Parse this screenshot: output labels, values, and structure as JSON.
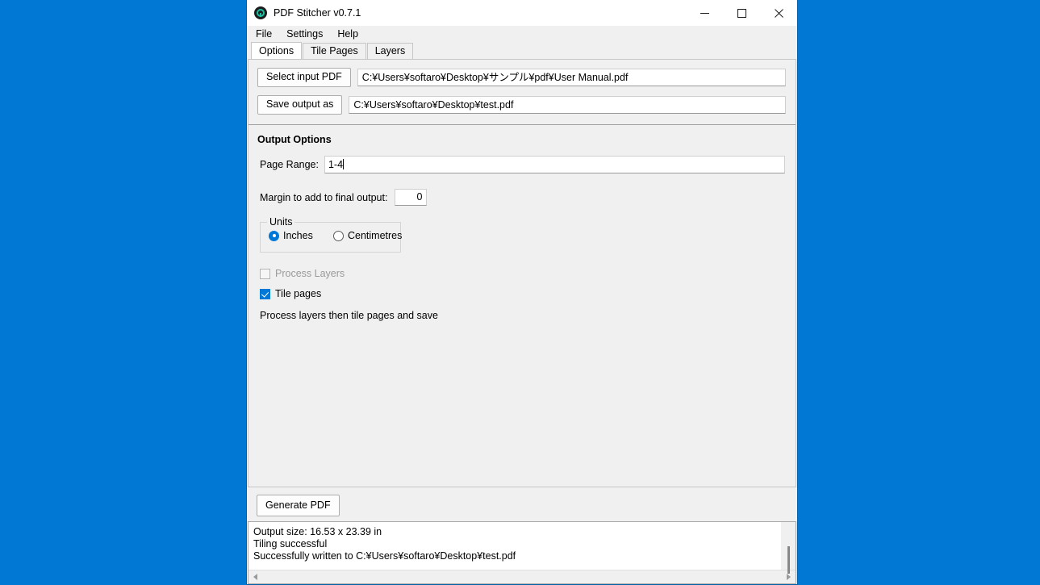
{
  "desktop": {
    "background_color": "#0078d4"
  },
  "window": {
    "title": "PDF Stitcher v0.7.1",
    "icon": "pdf-stitcher-app-icon",
    "controls": {
      "minimize": "minimize-icon",
      "maximize": "maximize-icon",
      "close": "close-icon"
    }
  },
  "menu": {
    "items": [
      {
        "label": "File"
      },
      {
        "label": "Settings"
      },
      {
        "label": "Help"
      }
    ]
  },
  "tabs": [
    {
      "label": "Options",
      "active": true
    },
    {
      "label": "Tile Pages",
      "active": false
    },
    {
      "label": "Layers",
      "active": false
    }
  ],
  "options_tab": {
    "input_row": {
      "button_label": "Select input PDF",
      "path_value": "C:¥Users¥softaro¥Desktop¥サンプル¥pdf¥User Manual.pdf"
    },
    "output_row": {
      "button_label": "Save output as",
      "path_value": "C:¥Users¥softaro¥Desktop¥test.pdf"
    },
    "output_options": {
      "title": "Output Options",
      "page_range": {
        "label": "Page Range:",
        "value": "1-4"
      },
      "margin": {
        "label": "Margin to add to final output:",
        "value": "0"
      },
      "units": {
        "legend": "Units",
        "selected": "Inches",
        "options": [
          {
            "label": "Inches",
            "checked": true
          },
          {
            "label": "Centimetres",
            "checked": false
          }
        ]
      },
      "process_layers": {
        "label": "Process Layers",
        "checked": false,
        "disabled": true
      },
      "tile_pages": {
        "label": "Tile pages",
        "checked": true,
        "disabled": false
      },
      "hint": "Process layers then tile pages and save"
    }
  },
  "action_bar": {
    "generate_label": "Generate PDF"
  },
  "log": {
    "lines": [
      "Output size: 16.53 x 23.39 in",
      "Tiling successful",
      "Successfully written to C:¥Users¥softaro¥Desktop¥test.pdf"
    ],
    "line1": "Output size: 16.53 x 23.39 in",
    "line2": "Tiling successful",
    "line3": "Successfully written to C:¥Users¥softaro¥Desktop¥test.pdf"
  },
  "colors": {
    "accent": "#0078d7",
    "window_bg": "#f0f0f0",
    "field_bg": "#ffffff"
  }
}
